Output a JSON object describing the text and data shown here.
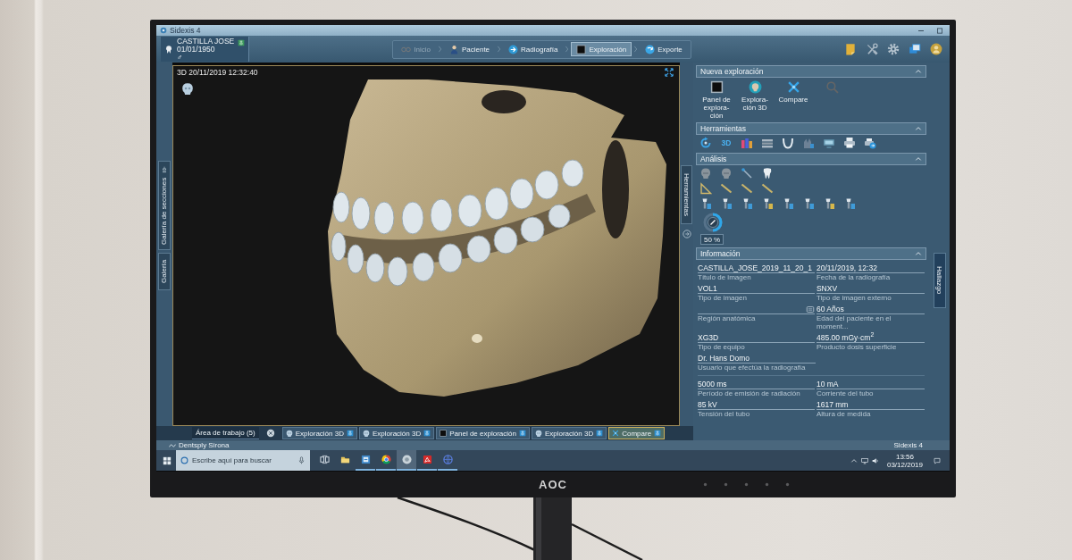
{
  "window": {
    "title": "Sidexis 4"
  },
  "patient": {
    "name": "CASTILLA JOSE",
    "birth_date": "01/01/1950",
    "sex": "♂"
  },
  "workflow": [
    {
      "label": "Inicio",
      "kind": "home",
      "selected": false,
      "disabled": true
    },
    {
      "label": "Paciente",
      "kind": "patient",
      "selected": false,
      "disabled": false
    },
    {
      "label": "Radiografía",
      "kind": "xray",
      "selected": false,
      "disabled": false
    },
    {
      "label": "Exploración",
      "kind": "exam",
      "selected": true,
      "disabled": false
    },
    {
      "label": "Exporte",
      "kind": "export",
      "selected": false,
      "disabled": false
    }
  ],
  "left_tabs": [
    {
      "label": "Galería de secciones",
      "kind": "pinned"
    },
    {
      "label": "Galería",
      "kind": "plain"
    }
  ],
  "viewer": {
    "title": "3D 20/11/2019 12:32:40"
  },
  "tools_tab": {
    "label": "Herramientas"
  },
  "panel": {
    "new_exam": {
      "title": "Nueva exploración",
      "expanded": true,
      "items": [
        {
          "label": "Panel de explora-ción",
          "kind": "panel",
          "disabled": false
        },
        {
          "label": "Explora-ción 3D",
          "kind": "volume",
          "disabled": false
        },
        {
          "label": "Compare",
          "kind": "compare",
          "disabled": false
        },
        {
          "kind": "search",
          "disabled": true
        }
      ]
    },
    "tools": {
      "title": "Herramientas",
      "expanded": true,
      "items": [
        {
          "kind": "rotate"
        },
        {
          "kind": "text",
          "label": "3D"
        },
        {
          "kind": "bars"
        },
        {
          "kind": "layers"
        },
        {
          "kind": "arch"
        },
        {
          "kind": "figure"
        },
        {
          "kind": "screen"
        },
        {
          "kind": "print"
        },
        {
          "kind": "share"
        }
      ]
    },
    "analysis": {
      "title": "Análisis",
      "expanded": true,
      "dial": {
        "level": 0.5,
        "reading": "50 %"
      }
    },
    "info": {
      "title": "Información",
      "expanded": true,
      "groups": [
        [
          [
            {
              "value": "CASTILLA_JOSE_2019_11_20_1",
              "label": "Título de imagen"
            },
            {
              "value": "20/11/2019, 12:32",
              "label": "Fecha de la radiografía"
            }
          ],
          [
            {
              "value": "VOL1",
              "label": "Tipo de imagen"
            },
            {
              "value": "SNXV",
              "label": "Tipo de imagen externo"
            }
          ],
          [
            {
              "label": "Región anatómica",
              "kind": "region"
            },
            {
              "value": "60 Años",
              "label": "Edad del paciente en el moment..."
            }
          ],
          [
            {
              "value": "XG3D",
              "label": "Tipo de equipo"
            },
            {
              "value": "485.00 mGy·cm$^{2}$",
              "label": "Producto dosis superficie"
            }
          ],
          [
            {
              "value": "Dr. Hans Domo",
              "label": "Usuario que efectúa la radiografía"
            }
          ]
        ],
        [
          [
            {
              "value": "5000 ms",
              "label": "Período de emisión de radiación"
            },
            {
              "value": "10 mA",
              "label": "Corriente del tubo"
            }
          ],
          [
            {
              "value": "85 kV",
              "label": "Tensión del tubo"
            },
            {
              "value": "1617 mm",
              "label": "Altura de medida"
            }
          ]
        ]
      ]
    }
  },
  "right_tab": {
    "label": "Hallazgo"
  },
  "workspace": {
    "label": "Área de trabajo (5)",
    "tabs": [
      {
        "label": "Exploración 3D",
        "kind": "volume",
        "selected": false
      },
      {
        "label": "Exploración 3D",
        "kind": "volume",
        "selected": false
      },
      {
        "label": "Panel de exploración",
        "kind": "panel",
        "selected": false
      },
      {
        "label": "Exploración 3D",
        "kind": "volume",
        "selected": false
      },
      {
        "label": "Compare",
        "kind": "compare",
        "selected": true
      }
    ]
  },
  "status_bar": {
    "vendor": "Dentsply Sirona",
    "product": "Sidexis 4"
  },
  "taskbar": {
    "search": {
      "placeholder": "Escribe aquí para buscar"
    },
    "apps": [
      {
        "kind": "taskview",
        "running": false,
        "selected": false
      },
      {
        "kind": "files",
        "running": false,
        "selected": false
      },
      {
        "kind": "app",
        "running": true,
        "selected": false
      },
      {
        "kind": "browser",
        "running": true,
        "selected": false
      },
      {
        "kind": "viewer",
        "running": true,
        "selected": true
      },
      {
        "kind": "reader",
        "running": true,
        "selected": false
      },
      {
        "kind": "web",
        "running": true,
        "selected": false
      }
    ],
    "time": "13:56",
    "date": "03/12/2019"
  },
  "monitor": {
    "brand": "AOC"
  }
}
